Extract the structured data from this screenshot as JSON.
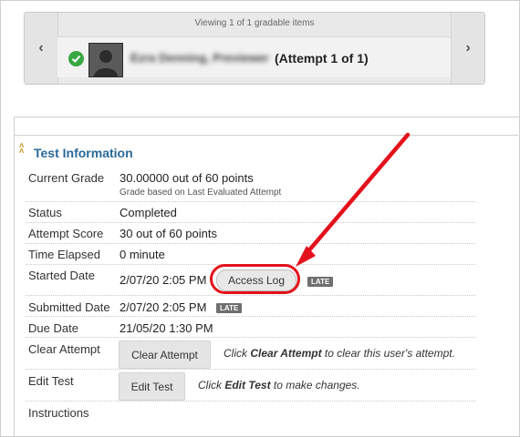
{
  "navigator": {
    "viewing_text": "Viewing 1 of 1 gradable items",
    "student_name": "Ezra Denning, Previewer",
    "attempt_label": "(Attempt 1 of 1)",
    "prev_icon": "chevron-left-icon",
    "next_icon": "chevron-right-icon",
    "status_icon": "check-circle-icon"
  },
  "section": {
    "title": "Test Information",
    "collapse_icon": "double-chevron-up-icon"
  },
  "rows": {
    "current_grade": {
      "label": "Current Grade",
      "value": "30.00000 out of 60 points",
      "sub": "Grade based on Last Evaluated Attempt"
    },
    "status": {
      "label": "Status",
      "value": "Completed"
    },
    "attempt_score": {
      "label": "Attempt Score",
      "value": "30 out of 60 points"
    },
    "time_elapsed": {
      "label": "Time Elapsed",
      "value": "0 minute"
    },
    "started_date": {
      "label": "Started Date",
      "value": "2/07/20 2:05 PM",
      "button": "Access Log",
      "badge": "LATE"
    },
    "submitted_date": {
      "label": "Submitted Date",
      "value": "2/07/20 2:05 PM",
      "badge": "LATE"
    },
    "due_date": {
      "label": "Due Date",
      "value": "21/05/20 1:30 PM"
    },
    "clear_attempt": {
      "label": "Clear Attempt",
      "button": "Clear Attempt",
      "hint_pre": "Click ",
      "hint_bold": "Clear Attempt",
      "hint_post": " to clear this user's attempt."
    },
    "edit_test": {
      "label": "Edit Test",
      "button": "Edit Test",
      "hint_pre": "Click ",
      "hint_bold": "Edit Test",
      "hint_post": " to make changes."
    },
    "instructions": {
      "label": "Instructions"
    }
  },
  "colors": {
    "annotation_red": "#e3121c",
    "title_blue": "#2a6a9a",
    "check_green": "#3aa641"
  }
}
